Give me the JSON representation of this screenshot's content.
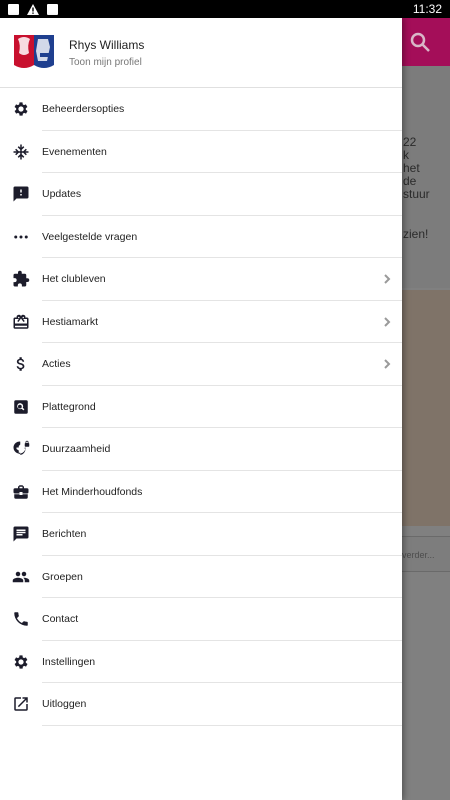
{
  "status_bar": {
    "time": "11:32",
    "icons": [
      "image-icon",
      "alert-icon",
      "app-icon"
    ]
  },
  "background": {
    "text_lines": [
      "22",
      "k",
      "het",
      "de",
      "stuur",
      "",
      "zien!"
    ],
    "input_placeholder": "verder..."
  },
  "profile": {
    "name": "Rhys Williams",
    "subtitle": "Toon mijn profiel"
  },
  "menu": [
    {
      "label": "Beheerdersopties",
      "icon": "gear-icon",
      "chevron": false
    },
    {
      "label": "Evenementen",
      "icon": "snowflake-icon",
      "chevron": false
    },
    {
      "label": "Updates",
      "icon": "feedback-icon",
      "chevron": false
    },
    {
      "label": "Veelgestelde vragen",
      "icon": "more-dots-icon",
      "chevron": false
    },
    {
      "label": "Het clubleven",
      "icon": "puzzle-icon",
      "chevron": true
    },
    {
      "label": "Hestiamarkt",
      "icon": "giftcard-icon",
      "chevron": true
    },
    {
      "label": "Acties",
      "icon": "dollar-icon",
      "chevron": true
    },
    {
      "label": "Plattegrond",
      "icon": "map-search-icon",
      "chevron": false
    },
    {
      "label": "Duurzaamheid",
      "icon": "globe-lock-icon",
      "chevron": false
    },
    {
      "label": "Het Minderhoudfonds",
      "icon": "briefcase-icon",
      "chevron": false
    },
    {
      "label": "Berichten",
      "icon": "chat-icon",
      "chevron": false
    },
    {
      "label": "Groepen",
      "icon": "people-icon",
      "chevron": false
    },
    {
      "label": "Contact",
      "icon": "phone-icon",
      "chevron": false
    },
    {
      "label": "Instellingen",
      "icon": "gear-icon",
      "chevron": false
    },
    {
      "label": "Uitloggen",
      "icon": "open-external-icon",
      "chevron": false
    }
  ],
  "colors": {
    "appbar": "#a40e59",
    "icon": "#1c1c2b",
    "logo_red": "#c8102e",
    "logo_blue": "#1f3f8f"
  }
}
